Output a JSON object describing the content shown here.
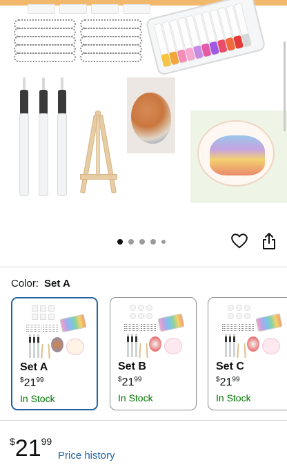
{
  "gallery": {
    "accent_color": "#f2b96c",
    "dots": {
      "count": 5,
      "active_index": 0
    },
    "actions": {
      "wishlist_icon": "heart-icon",
      "share_icon": "share-icon"
    }
  },
  "color": {
    "label": "Color:",
    "selected": "Set A"
  },
  "variants": [
    {
      "name": "Set A",
      "currency": "$",
      "whole": "21",
      "fraction": "99",
      "stock": "In Stock",
      "selected": true
    },
    {
      "name": "Set B",
      "currency": "$",
      "whole": "21",
      "fraction": "99",
      "stock": "In Stock",
      "selected": false
    },
    {
      "name": "Set C",
      "currency": "$",
      "whole": "21",
      "fraction": "99",
      "stock": "In Stock",
      "selected": false
    }
  ],
  "price": {
    "currency": "$",
    "whole": "21",
    "fraction": "99",
    "history_link": "Price history"
  },
  "colors": {
    "selected_border": "#2162a1",
    "in_stock": "#007600",
    "link": "#2162a1"
  }
}
